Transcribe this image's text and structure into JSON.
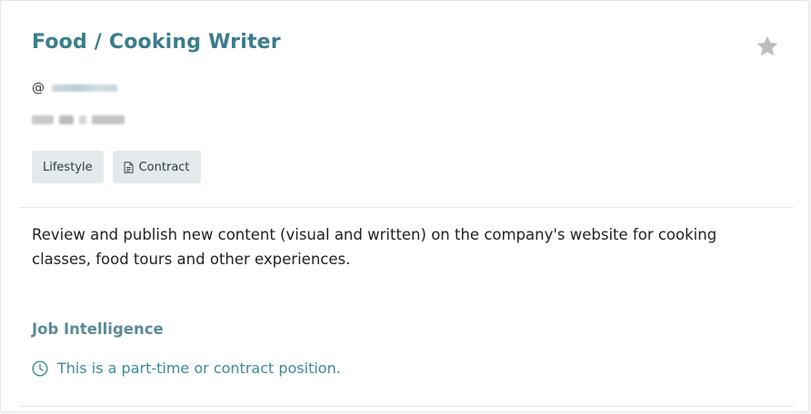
{
  "job": {
    "title": "Food / Cooking Writer",
    "handle_prefix": "@",
    "favorite_icon": "star-icon",
    "tags": [
      {
        "label": "Lifestyle",
        "icon": ""
      },
      {
        "label": "Contract",
        "icon": "document-icon"
      }
    ],
    "description": "Review and publish new content (visual and written) on the company's website for cooking classes, food tours and other experiences."
  },
  "intelligence": {
    "heading": "Job Intelligence",
    "items": [
      {
        "icon": "clock-icon",
        "text": "This is a part-time or contract position."
      }
    ]
  },
  "colors": {
    "title": "#3a7d8c",
    "heading": "#5b8a96",
    "intel_text": "#3a8a98",
    "tag_bg": "#e4eaec",
    "star": "#bdbdbd"
  }
}
